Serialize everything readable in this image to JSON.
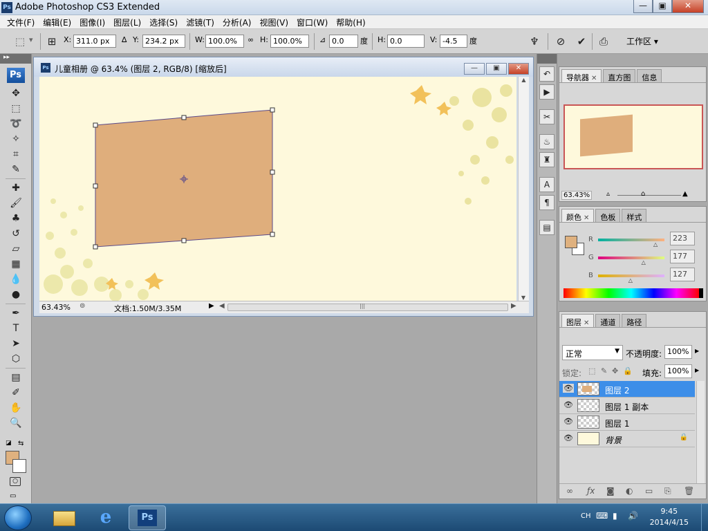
{
  "app": {
    "title": "Adobe Photoshop CS3 Extended",
    "logo_text": "Ps"
  },
  "window_controls": {
    "minimize": "—",
    "restore": "▣",
    "close": "✕"
  },
  "menu": [
    "文件(F)",
    "编辑(E)",
    "图像(I)",
    "图层(L)",
    "选择(S)",
    "滤镜(T)",
    "分析(A)",
    "视图(V)",
    "窗口(W)",
    "帮助(H)"
  ],
  "options": {
    "x_label": "X:",
    "x_value": "311.0 px",
    "y_label": "Y:",
    "y_value": "234.2 px",
    "w_label": "W:",
    "w_value": "100.0%",
    "h_label": "H:",
    "h_value": "100.0%",
    "angle_value": "0.0",
    "angle_unit": "度",
    "hskew_label": "H:",
    "hskew_value": "0.0",
    "vskew_label": "V:",
    "vskew_value": "-4.5",
    "vskew_unit": "度",
    "workspace_label": "工作区 ▾"
  },
  "document": {
    "title": "儿童相册 @ 63.4% (图层 2, RGB/8) [缩放后]",
    "zoom": "63.43%",
    "doc_info": "文档:1.50M/3.35M",
    "shape_color": "#dfae7c",
    "canvas_color": "#fef9dc"
  },
  "navigator": {
    "tabs": [
      "导航器",
      "直方图",
      "信息"
    ],
    "zoom": "63.43%"
  },
  "color_panel": {
    "tabs": [
      "颜色",
      "色板",
      "样式"
    ],
    "channels": [
      {
        "label": "R",
        "value": "223",
        "fraction": 0.875
      },
      {
        "label": "G",
        "value": "177",
        "fraction": 0.694
      },
      {
        "label": "B",
        "value": "127",
        "fraction": 0.498
      }
    ],
    "foreground": "#dfb17f"
  },
  "layers_panel": {
    "tabs": [
      "图层",
      "通道",
      "路径"
    ],
    "blend_mode": "正常",
    "opacity_label": "不透明度:",
    "opacity_value": "100%",
    "lock_label": "锁定:",
    "fill_label": "填充:",
    "fill_value": "100%",
    "layers": [
      {
        "name": "图层 2",
        "selected": true,
        "locked": false
      },
      {
        "name": "图层 1 副本",
        "selected": false,
        "locked": false
      },
      {
        "name": "图层 1",
        "selected": false,
        "locked": false
      },
      {
        "name": "背景",
        "selected": false,
        "locked": true
      }
    ]
  },
  "taskbar": {
    "ps_label": "Ps",
    "lang": "CH",
    "time": "9:45",
    "date": "2014/4/15"
  }
}
